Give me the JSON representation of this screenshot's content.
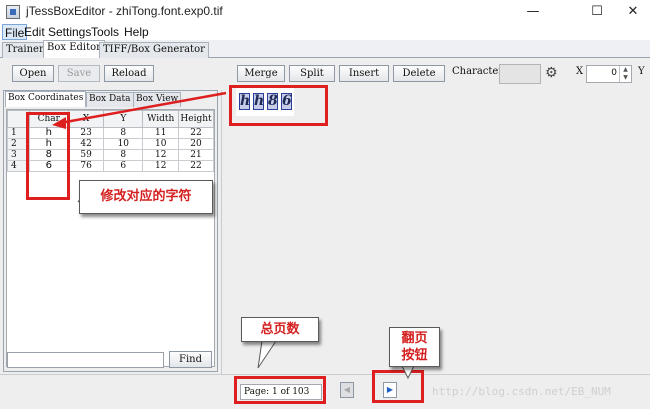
{
  "window": {
    "title": "jTessBoxEditor - zhiTong.font.exp0.tif",
    "minimize_glyph": "—",
    "maximize_glyph": "☐",
    "close_glyph": "✕"
  },
  "menu": [
    "File",
    "Edit",
    "Settings",
    "Tools",
    "Help"
  ],
  "tabs": [
    "Trainer",
    "Box Editor",
    "TIFF/Box Generator"
  ],
  "toolbar": {
    "open": "Open",
    "save": "Save",
    "reload": "Reload",
    "merge": "Merge",
    "split": "Split",
    "insert": "Insert",
    "delete": "Delete",
    "character_label": "Character",
    "character_value": "",
    "x_label": "X",
    "x_value": "0",
    "y_label": "Y"
  },
  "left_tabs": [
    "Box Coordinates",
    "Box Data",
    "Box View"
  ],
  "table": {
    "columns": [
      "Char",
      "X",
      "Y",
      "Width",
      "Height"
    ],
    "rows": [
      {
        "num": "1",
        "char": "h",
        "x": "23",
        "y": "8",
        "width": "11",
        "height": "22"
      },
      {
        "num": "2",
        "char": "h",
        "x": "42",
        "y": "10",
        "width": "10",
        "height": "20"
      },
      {
        "num": "3",
        "char": "8",
        "x": "59",
        "y": "8",
        "width": "12",
        "height": "21"
      },
      {
        "num": "4",
        "char": "6",
        "x": "76",
        "y": "6",
        "width": "12",
        "height": "22"
      }
    ]
  },
  "find": {
    "value": "",
    "button": "Find"
  },
  "glyphs": [
    "h",
    "h",
    "8",
    "6"
  ],
  "pagination": {
    "text": "Page: 1 of 103",
    "prev_glyph": "◀",
    "next_glyph": "▶"
  },
  "annotations": {
    "modify_char": "修改对应的字符",
    "total_pages": "总页数",
    "page_button_line1": "翻页",
    "page_button_line2": "按钮"
  },
  "watermark": "http://blog.csdn.net/EB_NUM",
  "colors": {
    "annotation_red": "#dd1f1f",
    "glyph_fill": "#c7cde9",
    "glyph_border": "#2b3f9c"
  }
}
